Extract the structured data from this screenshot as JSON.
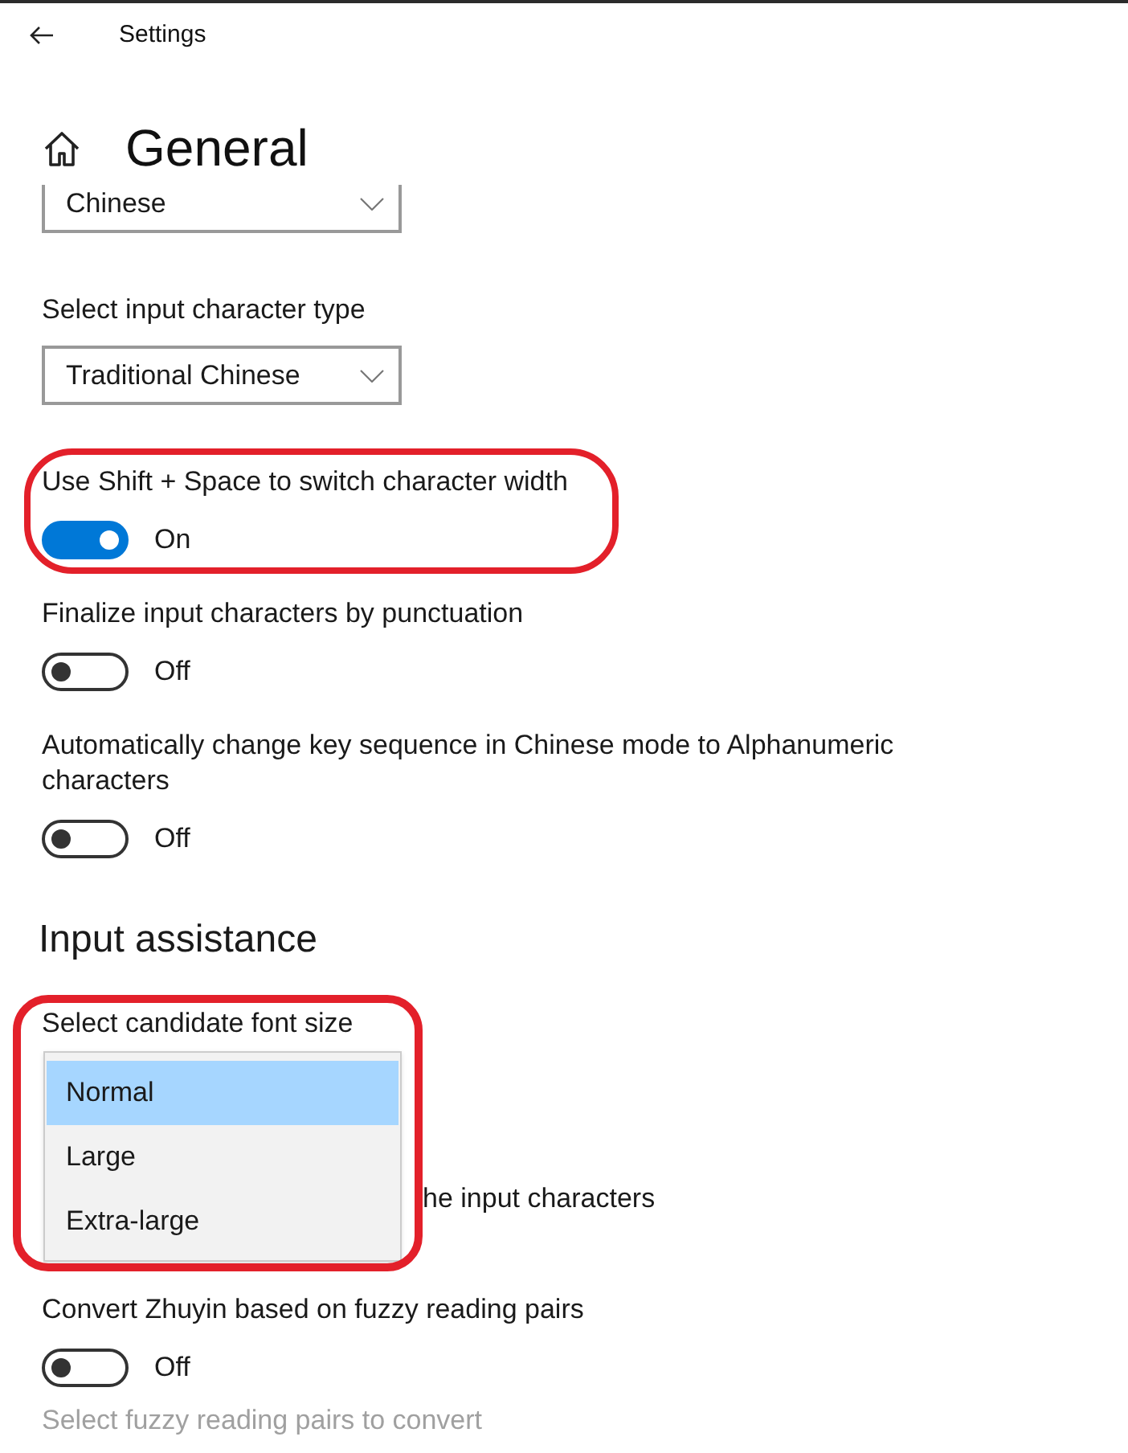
{
  "header": {
    "title": "Settings"
  },
  "page_title": "General",
  "items": [
    {
      "kind": "dropdown",
      "value": "Chinese"
    },
    {
      "kind": "dropdown",
      "label": "Select input character type",
      "value": "Traditional Chinese"
    },
    {
      "kind": "toggle",
      "label": "Use Shift + Space to switch character width",
      "on": true,
      "state_label": "On",
      "highlighted": true
    },
    {
      "kind": "toggle",
      "label": "Finalize input characters by punctuation",
      "on": false,
      "state_label": "Off"
    },
    {
      "kind": "toggle",
      "label": "Automatically change key sequence in Chinese mode to Alphanumeric characters",
      "on": false,
      "state_label": "Off"
    },
    {
      "kind": "heading",
      "text": "Input assistance"
    },
    {
      "kind": "open_dropdown",
      "label": "Select candidate font size",
      "highlighted": true,
      "options": [
        {
          "label": "Normal",
          "selected": true
        },
        {
          "label": "Large",
          "selected": false
        },
        {
          "label": "Extra-large",
          "selected": false
        }
      ]
    },
    {
      "kind": "covered_label",
      "text": "he input characters"
    },
    {
      "kind": "toggle",
      "label": "Convert Zhuyin based on fuzzy reading pairs",
      "on": false,
      "state_label": "Off"
    },
    {
      "kind": "link",
      "text": "Select fuzzy reading pairs to convert",
      "disabled": true
    }
  ]
}
